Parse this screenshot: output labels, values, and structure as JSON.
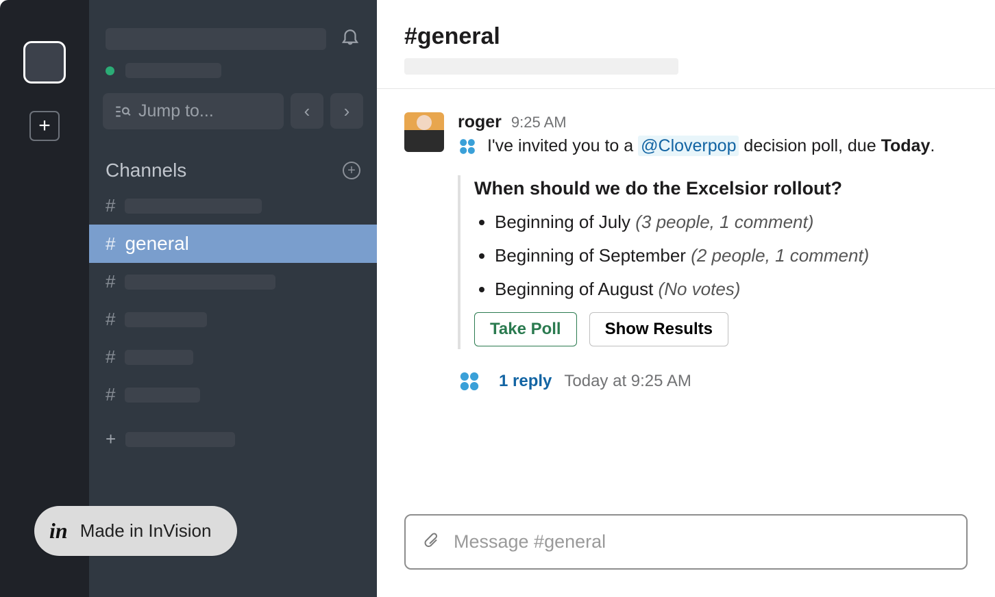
{
  "sidebar": {
    "jump_placeholder": "Jump to...",
    "channels_heading": "Channels",
    "channels": [
      {
        "name": "",
        "active": false,
        "phWidth": 200
      },
      {
        "name": "general",
        "active": true
      },
      {
        "name": "",
        "active": false,
        "phWidth": 220
      },
      {
        "name": "",
        "active": false,
        "phWidth": 120
      },
      {
        "name": "",
        "active": false,
        "phWidth": 100
      },
      {
        "name": "",
        "active": false,
        "phWidth": 110
      }
    ]
  },
  "header": {
    "channel_title": "#general"
  },
  "message": {
    "author": "roger",
    "time": "9:25 AM",
    "invite_prefix": "I've invited you to a ",
    "mention": "@Cloverpop",
    "invite_mid": " decision poll, due ",
    "invite_due": "Today",
    "invite_suffix": ".",
    "poll_question": "When should we do the Excelsior rollout?",
    "options": [
      {
        "label": "Beginning of July",
        "stats": "(3 people, 1 comment)"
      },
      {
        "label": "Beginning of September",
        "stats": "(2 people, 1 comment)"
      },
      {
        "label": "Beginning of August",
        "stats": "(No votes)"
      }
    ],
    "take_poll": "Take Poll",
    "show_results": "Show Results",
    "reply_count": "1 reply",
    "reply_time": "Today at 9:25 AM"
  },
  "composer": {
    "placeholder": "Message #general"
  },
  "badge": {
    "text": "Made in InVision",
    "logo": "in"
  }
}
